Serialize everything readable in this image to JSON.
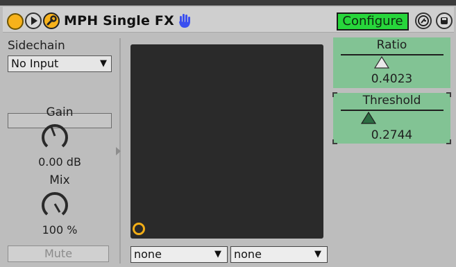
{
  "device": {
    "title": "MPH Single FX",
    "configure_label": "Configure",
    "accent": "#f7b21b",
    "configure_color": "#27d63b",
    "panel_color": "#82c394",
    "xy_pad_color": "#2a2a2a"
  },
  "icons": {
    "power": "power-circle-icon",
    "play": "play-icon",
    "wrench": "wrench-icon",
    "hand": "hand-icon",
    "function": "function-icon",
    "save": "save-icon"
  },
  "sidechain": {
    "label": "Sidechain",
    "selected": "No Input"
  },
  "gain": {
    "label": "Gain",
    "value": "0.00 dB"
  },
  "mix": {
    "label": "Mix",
    "value": "100 %"
  },
  "mute_label": "Mute",
  "xy_pad": {
    "dropdown_x": "none",
    "dropdown_y": "none"
  },
  "params": [
    {
      "name": "Ratio",
      "value": "0.4023",
      "position": 0.4023,
      "filled": false
    },
    {
      "name": "Threshold",
      "value": "0.2744",
      "position": 0.2744,
      "filled": true
    }
  ]
}
